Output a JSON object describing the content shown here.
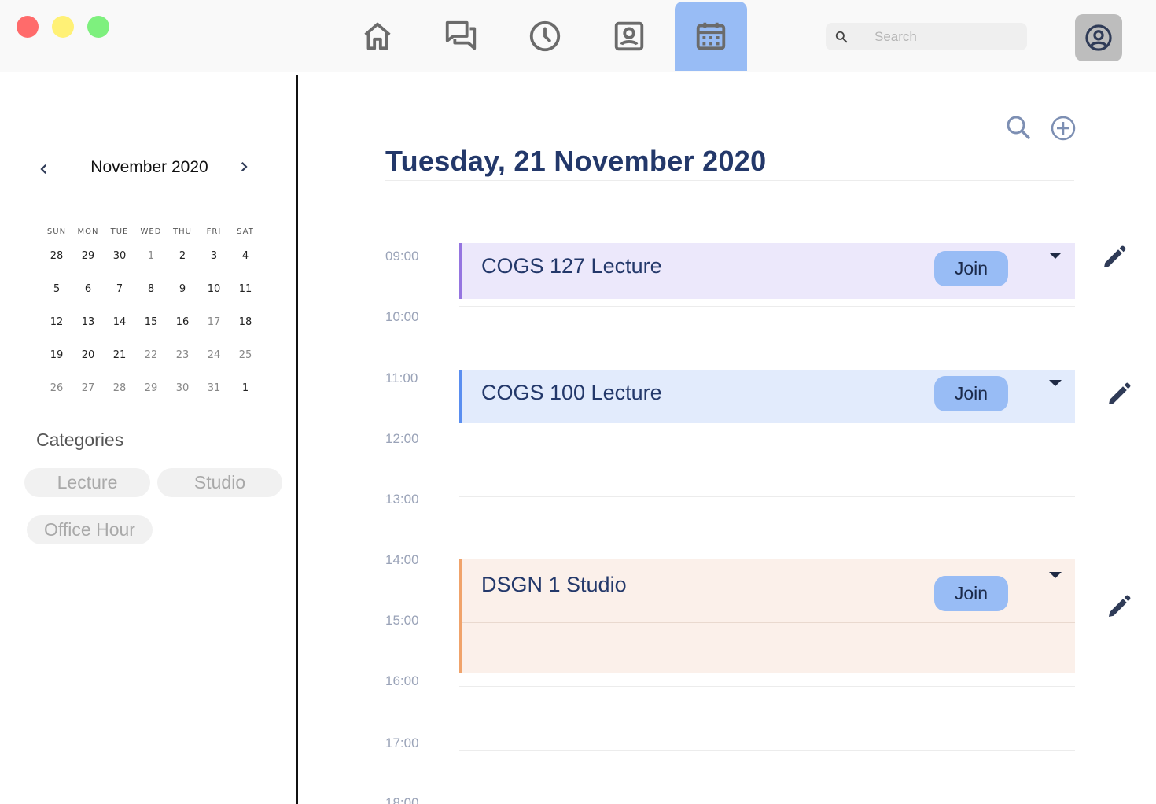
{
  "window": {
    "traffic_lights": [
      "#ff6b6b",
      "#fff176",
      "#7ef07e"
    ]
  },
  "nav": {
    "items": [
      {
        "name": "home",
        "icon": "home-icon"
      },
      {
        "name": "messages",
        "icon": "chat-icon"
      },
      {
        "name": "recent",
        "icon": "clock-icon"
      },
      {
        "name": "contacts",
        "icon": "contact-card-icon"
      },
      {
        "name": "calendar",
        "icon": "calendar-icon",
        "active": true
      }
    ],
    "active_color": "#98bcf5"
  },
  "search": {
    "placeholder": "Search",
    "value": ""
  },
  "sidebar": {
    "month_title": "November 2020",
    "weekdays": [
      "SUN",
      "MON",
      "TUE",
      "WED",
      "THU",
      "FRI",
      "SAT"
    ],
    "weeks": [
      [
        "28",
        "29",
        "30",
        "1",
        "2",
        "3",
        "4"
      ],
      [
        "5",
        "6",
        "7",
        "8",
        "9",
        "10",
        "11"
      ],
      [
        "12",
        "13",
        "14",
        "15",
        "16",
        "17",
        "18"
      ],
      [
        "19",
        "20",
        "21",
        "22",
        "23",
        "24",
        "25"
      ],
      [
        "26",
        "27",
        "28",
        "29",
        "30",
        "31",
        "1"
      ]
    ],
    "selected_day": "21",
    "categories_title": "Categories",
    "categories": [
      "Lecture",
      "Studio",
      "Office Hour"
    ]
  },
  "main": {
    "day_title": "Tuesday, 21 November 2020",
    "times": [
      "09:00",
      "10:00",
      "11:00",
      "12:00",
      "13:00",
      "14:00",
      "15:00",
      "16:00",
      "17:00",
      "18:00"
    ],
    "events": [
      {
        "title": "COGS 127 Lecture",
        "join_label": "Join",
        "bg": "#ece8fb",
        "bar": "#9575e0"
      },
      {
        "title": "COGS 100 Lecture",
        "join_label": "Join",
        "bg": "#e2ebfc",
        "bar": "#5a8ef0"
      },
      {
        "title": "DSGN 1 Studio",
        "join_label": "Join",
        "bg": "#fbf0ea",
        "bar": "#f0a36b"
      }
    ]
  },
  "colors": {
    "title": "#23386a",
    "join_button": "#98bcf5",
    "icon_gray": "#6b6b6b",
    "icon_blue_gray": "#7d8fb3"
  }
}
